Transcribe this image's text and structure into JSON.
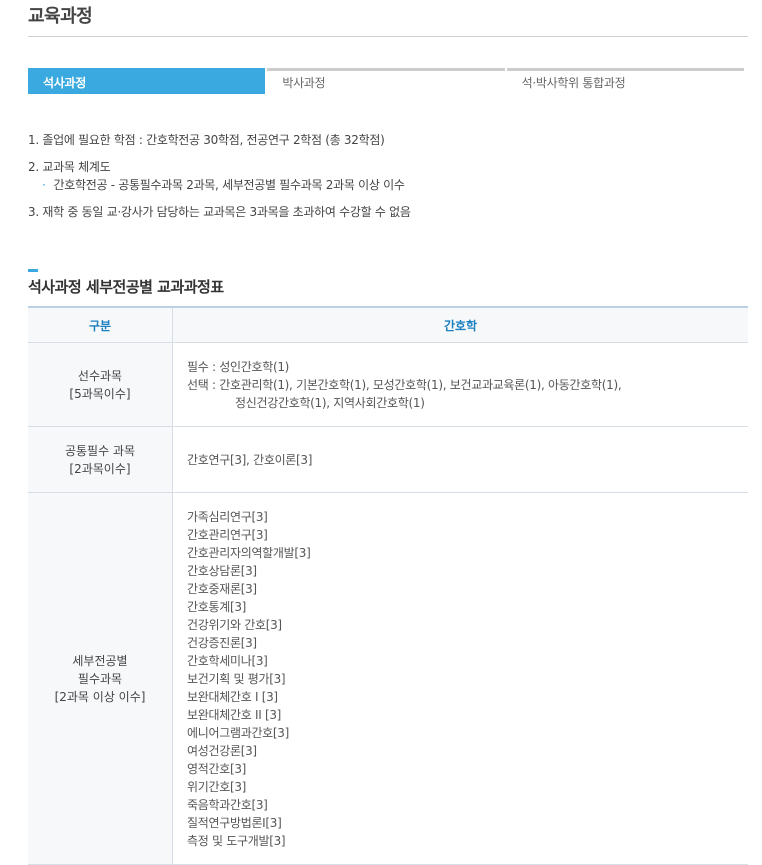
{
  "page": {
    "title": "교육과정"
  },
  "tabs": [
    {
      "label": "석사과정",
      "active": true
    },
    {
      "label": "박사과정",
      "active": false
    },
    {
      "label": "석·박사학위 통합과정",
      "active": false
    }
  ],
  "notes": {
    "n1": "1. 졸업에 필요한 학점 : 간호학전공 30학점, 전공연구 2학점 (총 32학점)",
    "n2": "2. 교과목 체계도",
    "n2_sub": "간호학전공 - 공통필수과목 2과목, 세부전공별 필수과목 2과목 이상 이수",
    "n3": "3. 재학 중 동일 교·강사가 담당하는 교과목은 3과목을 초과하여 수강할 수 없음"
  },
  "section": {
    "title": "석사과정 세부전공별 교과과정표"
  },
  "table": {
    "headers": [
      "구분",
      "간호학"
    ],
    "rows": [
      {
        "category": [
          "선수과목",
          "[5과목이수]"
        ],
        "required": "필수 : 성인간호학(1)",
        "elective": "선택 : 간호관리학(1), 기본간호학(1), 모성간호학(1), 보건교과교육론(1), 아동간호학(1),",
        "elective_cont": "정신건강간호학(1), 지역사회간호학(1)"
      },
      {
        "category": [
          "공통필수 과목",
          "[2과목이수]"
        ],
        "content": "간호연구[3], 간호이론[3]"
      },
      {
        "category": [
          "세부전공별",
          "필수과목",
          "[2과목 이상 이수]"
        ],
        "courses": [
          "가족심리연구[3]",
          "간호관리연구[3]",
          "간호관리자의역할개발[3]",
          "간호상담론[3]",
          "간호중재론[3]",
          "간호통계[3]",
          "건강위기와 간호[3]",
          "건강증진론[3]",
          "간호학세미나[3]",
          "보건기획 및 평가[3]",
          "보완대체간호 I [3]",
          "보완대체간호 II [3]",
          "에니어그램과간호[3]",
          "여성건강론[3]",
          "영적간호[3]",
          "위기간호[3]",
          "죽음학과간호[3]",
          "질적연구방법론I[3]",
          "측정 및 도구개발[3]"
        ]
      }
    ]
  },
  "colors": {
    "accent": "#3aa9df",
    "header_text": "#1a7fc1"
  }
}
